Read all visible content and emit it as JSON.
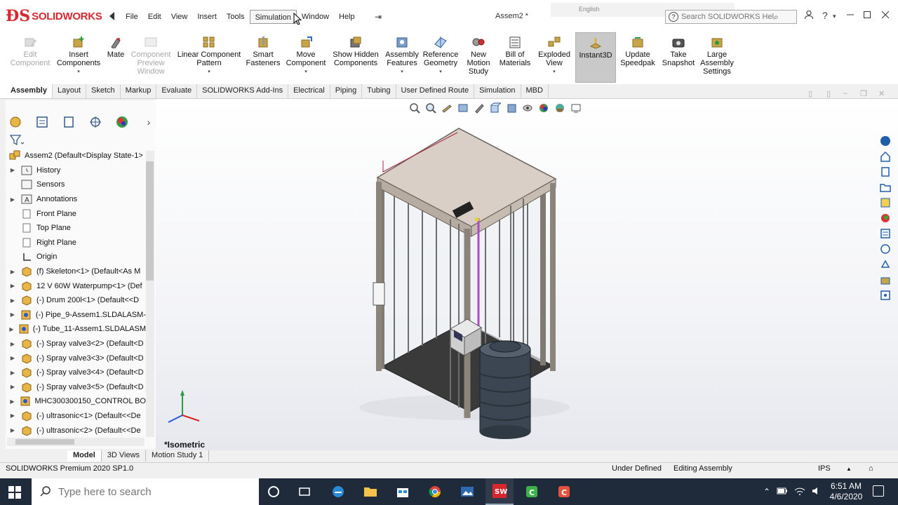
{
  "app": {
    "brand": "SOLIDWORKS",
    "document_title": "Assem2 *",
    "language_label": "English",
    "search_placeholder": "Search SOLIDWORKS Help",
    "accent_color": "#d7282f"
  },
  "menu": [
    "File",
    "Edit",
    "View",
    "Insert",
    "Tools",
    "Simulation",
    "Window",
    "Help"
  ],
  "commands": [
    {
      "label": "Edit Component",
      "state": "disabled"
    },
    {
      "label": "Insert Components",
      "state": "enabled"
    },
    {
      "label": "Mate",
      "state": "enabled"
    },
    {
      "label": "Component Preview Window",
      "state": "disabled"
    },
    {
      "label": "Linear Component Pattern",
      "state": "enabled"
    },
    {
      "label": "Smart Fasteners",
      "state": "enabled"
    },
    {
      "label": "Move Component",
      "state": "enabled"
    },
    {
      "label": "Show Hidden Components",
      "state": "enabled"
    },
    {
      "label": "Assembly Features",
      "state": "enabled"
    },
    {
      "label": "Reference Geometry",
      "state": "enabled"
    },
    {
      "label": "New Motion Study",
      "state": "enabled"
    },
    {
      "label": "Bill of Materials",
      "state": "enabled"
    },
    {
      "label": "Exploded View",
      "state": "enabled"
    },
    {
      "label": "Instant3D",
      "state": "active"
    },
    {
      "label": "Update Speedpak",
      "state": "enabled"
    },
    {
      "label": "Take Snapshot",
      "state": "enabled"
    },
    {
      "label": "Large Assembly Settings",
      "state": "enabled"
    }
  ],
  "tabs": [
    "Assembly",
    "Layout",
    "Sketch",
    "Markup",
    "Evaluate",
    "SOLIDWORKS Add-Ins",
    "Electrical",
    "Piping",
    "Tubing",
    "User Defined Route",
    "Simulation",
    "MBD"
  ],
  "active_tab": "Assembly",
  "tree": [
    {
      "label": "Assem2  (Default<Display State-1>",
      "icon": "assembly-icon",
      "expander": "none"
    },
    {
      "label": "History",
      "icon": "history-icon",
      "expander": "collapsed"
    },
    {
      "label": "Sensors",
      "icon": "sensor-icon",
      "expander": "none"
    },
    {
      "label": "Annotations",
      "icon": "annotation-icon",
      "expander": "collapsed"
    },
    {
      "label": "Front Plane",
      "icon": "plane-icon",
      "expander": "none"
    },
    {
      "label": "Top Plane",
      "icon": "plane-icon",
      "expander": "none"
    },
    {
      "label": "Right Plane",
      "icon": "plane-icon",
      "expander": "none"
    },
    {
      "label": "Origin",
      "icon": "origin-icon",
      "expander": "none"
    },
    {
      "label": "(f) Skeleton<1> (Default<As M",
      "icon": "part-icon",
      "expander": "collapsed"
    },
    {
      "label": "12 V 60W Waterpump<1> (Def",
      "icon": "part-icon",
      "expander": "collapsed"
    },
    {
      "label": "(-) Drum 200l<1> (Default<<D",
      "icon": "part-icon",
      "expander": "collapsed"
    },
    {
      "label": "(-) Pipe_9-Assem1.SLDALASM-",
      "icon": "subassembly-icon",
      "expander": "collapsed"
    },
    {
      "label": "(-) Tube_11-Assem1.SLDALASM",
      "icon": "subassembly-icon",
      "expander": "collapsed"
    },
    {
      "label": "(-) Spray valve3<2> (Default<D",
      "icon": "part-icon",
      "expander": "collapsed"
    },
    {
      "label": "(-) Spray valve3<3> (Default<D",
      "icon": "part-icon",
      "expander": "collapsed"
    },
    {
      "label": "(-) Spray valve3<4> (Default<D",
      "icon": "part-icon",
      "expander": "collapsed"
    },
    {
      "label": "(-) Spray valve3<5> (Default<D",
      "icon": "part-icon",
      "expander": "collapsed"
    },
    {
      "label": "MHC300300150_CONTROL BO",
      "icon": "subassembly-icon",
      "expander": "collapsed"
    },
    {
      "label": "(-) ultrasonic<1> (Default<<De",
      "icon": "part-icon",
      "expander": "collapsed"
    },
    {
      "label": "(-) ultrasonic<2> (Default<<De",
      "icon": "part-icon",
      "expander": "collapsed"
    }
  ],
  "graphics": {
    "view_name": "*Isometric"
  },
  "bottom_tabs": [
    "Model",
    "3D Views",
    "Motion Study 1"
  ],
  "active_bottom_tab": "Model",
  "status": {
    "product": "SOLIDWORKS Premium 2020 SP1.0",
    "definition": "Under Defined",
    "mode": "Editing Assembly",
    "units": "IPS"
  },
  "taskbar": {
    "search_placeholder": "Type here to search",
    "time": "6:51 AM",
    "date": "4/6/2020"
  }
}
